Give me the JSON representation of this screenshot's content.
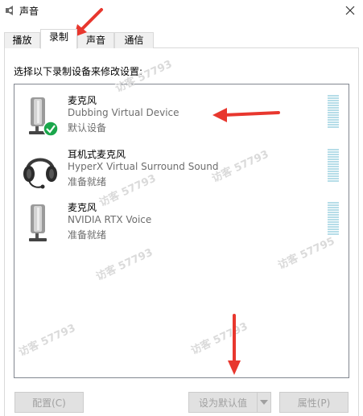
{
  "window": {
    "title": "声音",
    "icon": "speaker-icon",
    "close_icon": "close-icon"
  },
  "tabs": [
    {
      "label": "播放",
      "active": false
    },
    {
      "label": "录制",
      "active": true
    },
    {
      "label": "声音",
      "active": false
    },
    {
      "label": "通信",
      "active": false
    }
  ],
  "instruction": "选择以下录制设备来修改设置:",
  "devices": [
    {
      "name": "麦克风",
      "description": "Dubbing Virtual Device",
      "status": "默认设备",
      "icon": "microphone-icon",
      "default_badge": "check-badge-icon"
    },
    {
      "name": "耳机式麦克风",
      "description": "HyperX Virtual Surround Sound",
      "status": "准备就绪",
      "icon": "headset-icon"
    },
    {
      "name": "麦克风",
      "description": "NVIDIA RTX Voice",
      "status": "准备就绪",
      "icon": "microphone-icon"
    }
  ],
  "buttons": {
    "configure": "配置(C)",
    "set_default": "设为默认值(S)",
    "properties": "属性(P)"
  },
  "watermarks": [
    "访客 57793",
    "访客 57793",
    "访客 57793",
    "访客 57793",
    "访客 57795",
    "访客 57793",
    "访客 57793"
  ],
  "colors": {
    "accent_green": "#1aa64b",
    "meter_color": "#b6dde8",
    "arrow_red": "#e8372e",
    "disabled_text": "#a0a0a0"
  }
}
